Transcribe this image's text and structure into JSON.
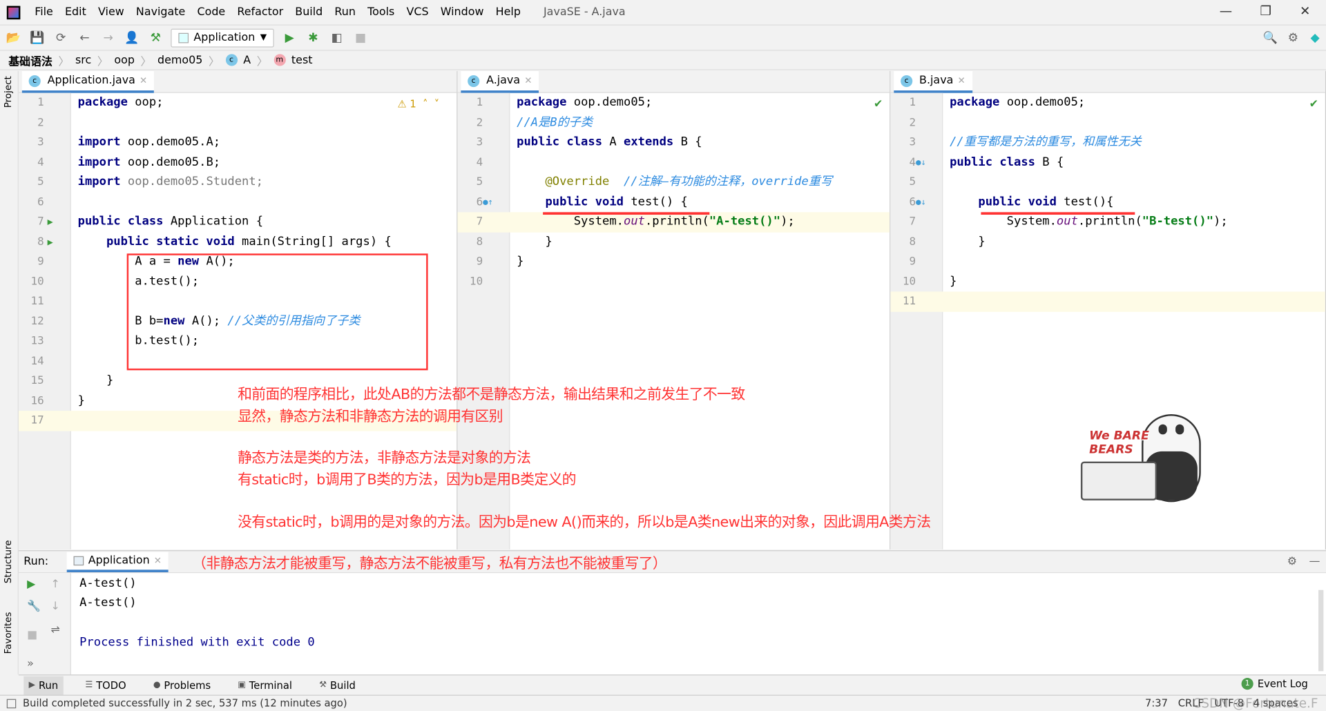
{
  "window": {
    "title": "JavaSE - A.java"
  },
  "menu": [
    "File",
    "Edit",
    "View",
    "Navigate",
    "Code",
    "Refactor",
    "Build",
    "Run",
    "Tools",
    "VCS",
    "Window",
    "Help"
  ],
  "toolbar": {
    "run_config": "Application"
  },
  "breadcrumb": [
    "基础语法",
    "src",
    "oop",
    "demo05",
    "A",
    "test"
  ],
  "sidebar": {
    "project": "Project",
    "structure": "Structure",
    "favorites": "Favorites"
  },
  "editors": [
    {
      "tab": "Application.java",
      "warning": "1",
      "current_line": 17,
      "lines": [
        [
          [
            "package",
            "kw"
          ],
          [
            " oop;",
            ""
          ]
        ],
        [],
        [
          [
            "import",
            "kw"
          ],
          [
            " oop.demo05.A;",
            ""
          ]
        ],
        [
          [
            "import",
            "kw"
          ],
          [
            " oop.demo05.B;",
            ""
          ]
        ],
        [
          [
            "import",
            "kw"
          ],
          [
            " oop.demo05.Student;",
            "gr"
          ]
        ],
        [],
        [
          [
            "public class",
            "kw"
          ],
          [
            " Application {",
            ""
          ]
        ],
        [
          [
            "    public static void",
            "kw"
          ],
          [
            " main(String[] args) {",
            ""
          ]
        ],
        [
          [
            "        A a = ",
            ""
          ],
          [
            "new",
            "kw"
          ],
          [
            " A();",
            ""
          ]
        ],
        [
          [
            "        a.test();",
            ""
          ]
        ],
        [],
        [
          [
            "        B b=",
            ""
          ],
          [
            "new",
            "kw"
          ],
          [
            " A(); ",
            ""
          ],
          [
            "//父类的引用指向了子类",
            "cm"
          ]
        ],
        [
          [
            "        b.test();",
            ""
          ]
        ],
        [],
        [
          [
            "    }",
            ""
          ]
        ],
        [
          [
            "}",
            ""
          ]
        ],
        []
      ]
    },
    {
      "tab": "A.java",
      "current_line": 7,
      "lines": [
        [
          [
            "package",
            "kw"
          ],
          [
            " oop.demo05;",
            ""
          ]
        ],
        [
          [
            "//A是B的子类",
            "cm"
          ]
        ],
        [
          [
            "public class",
            "kw"
          ],
          [
            " A ",
            ""
          ],
          [
            "extends",
            "kw"
          ],
          [
            " B {",
            ""
          ]
        ],
        [],
        [
          [
            "    @Override",
            "an"
          ],
          [
            "  //注解—有功能的注释，override重写",
            "cm"
          ]
        ],
        [
          [
            "    public void",
            "kw"
          ],
          [
            " test() {",
            ""
          ]
        ],
        [
          [
            "        System.",
            ""
          ],
          [
            "out",
            "fi"
          ],
          [
            ".println(",
            ""
          ],
          [
            "\"A-test()\"",
            "st"
          ],
          [
            ");",
            ""
          ]
        ],
        [
          [
            "    }",
            ""
          ]
        ],
        [
          [
            "}",
            ""
          ]
        ],
        []
      ]
    },
    {
      "tab": "B.java",
      "current_line": 11,
      "lines": [
        [
          [
            "package",
            "kw"
          ],
          [
            " oop.demo05;",
            ""
          ]
        ],
        [],
        [
          [
            "//重写都是方法的重写，和属性无关",
            "cm"
          ]
        ],
        [
          [
            "public class",
            "kw"
          ],
          [
            " B {",
            ""
          ]
        ],
        [],
        [
          [
            "    public void",
            "kw"
          ],
          [
            " test(){",
            ""
          ]
        ],
        [
          [
            "        System.",
            ""
          ],
          [
            "out",
            "fi"
          ],
          [
            ".println(",
            ""
          ],
          [
            "\"B-test()\"",
            "st"
          ],
          [
            ");",
            ""
          ]
        ],
        [
          [
            "    }",
            ""
          ]
        ],
        [],
        [
          [
            "}",
            ""
          ]
        ],
        []
      ]
    }
  ],
  "annotations": [
    "和前面的程序相比，此处AB的方法都不是静态方法，输出结果和之前发生了不一致",
    "显然，静态方法和非静态方法的调用有区别",
    "静态方法是类的方法，非静态方法是对象的方法",
    "有static时，b调用了B类的方法，因为b是用B类定义的",
    "没有static时，b调用的是对象的方法。因为b是new A()而来的，所以b是A类new出来的对象，因此调用A类方法",
    "（非静态方法才能被重写，静态方法不能被重写，私有方法也不能被重写了）"
  ],
  "sticker": {
    "logo": "We BARE BEARS"
  },
  "run": {
    "label": "Run:",
    "tab": "Application",
    "output": [
      "A-test()",
      "A-test()",
      "",
      "Process finished with exit code 0"
    ]
  },
  "tool_windows": [
    "Run",
    "TODO",
    "Problems",
    "Terminal",
    "Build"
  ],
  "event_log": {
    "count": "1",
    "label": "Event Log"
  },
  "status": {
    "message": "Build completed successfully in 2 sec, 537 ms (12 minutes ago)",
    "position": "7:37",
    "line_sep": "CRLF",
    "encoding": "UTF-8",
    "indent": "4 spaces",
    "watermark": "CSDN @Fortunate.F"
  },
  "colors": {
    "accent": "#4083c9",
    "annotation": "#ff3333",
    "current_line": "#fefbe6"
  }
}
